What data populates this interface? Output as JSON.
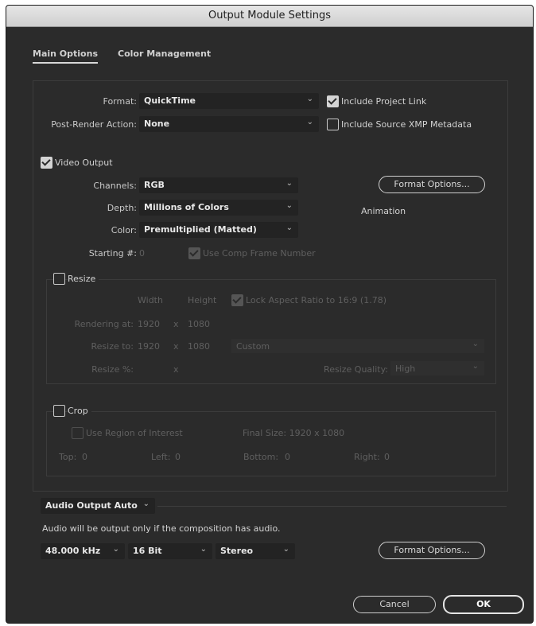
{
  "window": {
    "title": "Output Module Settings"
  },
  "tabs": {
    "main": "Main Options",
    "color": "Color Management"
  },
  "main": {
    "format_label": "Format:",
    "format_value": "QuickTime",
    "post_render_label": "Post-Render Action:",
    "post_render_value": "None",
    "include_project_link": "Include Project Link",
    "include_xmp": "Include Source XMP Metadata"
  },
  "video": {
    "label": "Video Output",
    "channels_label": "Channels:",
    "channels_value": "RGB",
    "depth_label": "Depth:",
    "depth_value": "Millions of Colors",
    "color_label": "Color:",
    "color_value": "Premultiplied (Matted)",
    "starting_label": "Starting #:",
    "starting_value": "0",
    "use_comp_frame": "Use Comp Frame Number",
    "format_options": "Format Options...",
    "codec_info": "Animation"
  },
  "resize": {
    "label": "Resize",
    "width_header": "Width",
    "height_header": "Height",
    "lock_aspect": "Lock Aspect Ratio to 16:9 (1.78)",
    "rendering_label": "Rendering at:",
    "rendering_w": "1920",
    "rendering_h": "1080",
    "resize_to_label": "Resize to:",
    "resize_to_w": "1920",
    "resize_to_h": "1080",
    "preset_value": "Custom",
    "resize_pct_label": "Resize %:",
    "quality_label": "Resize Quality:",
    "quality_value": "High",
    "x": "x"
  },
  "crop": {
    "label": "Crop",
    "use_roi": "Use Region of Interest",
    "final_size": "Final Size: 1920 x 1080",
    "top_label": "Top:",
    "top_value": "0",
    "left_label": "Left:",
    "left_value": "0",
    "bottom_label": "Bottom:",
    "bottom_value": "0",
    "right_label": "Right:",
    "right_value": "0"
  },
  "audio": {
    "output_value": "Audio Output Auto",
    "note": "Audio will be output only if the composition has audio.",
    "rate_value": "48.000 kHz",
    "bits_value": "16 Bit",
    "channels_value": "Stereo",
    "format_options": "Format Options..."
  },
  "footer": {
    "cancel": "Cancel",
    "ok": "OK"
  },
  "icons": {
    "dropdown": "chevron-down-icon",
    "check": "check-icon"
  },
  "colors": {
    "dialog_bg": "#2b2b2b",
    "field_bg": "#232323",
    "titlebar": "#dcdcdc"
  }
}
